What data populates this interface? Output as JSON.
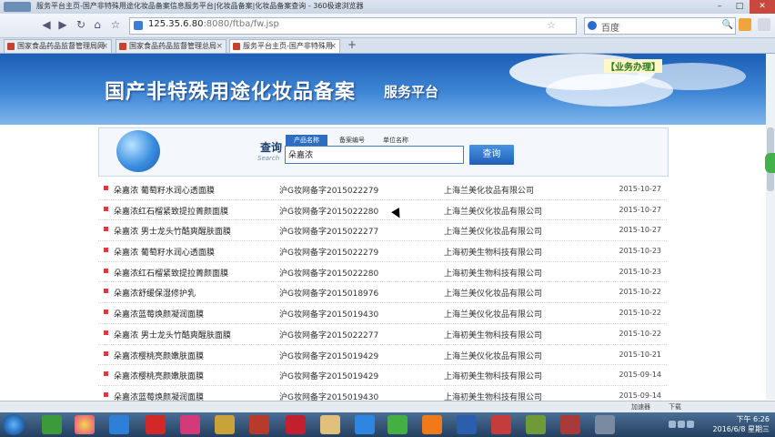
{
  "window": {
    "title": "服务平台主页-国产非特殊用途化妆品备案信息服务平台|化妆品备案|化妆品备案查询 - 360极速浏览器"
  },
  "address": {
    "url_main": "125.35.6.80",
    "url_rest": ":8080/ftba/fw.jsp",
    "search_placeholder": "百度"
  },
  "tabs": [
    {
      "label": "国家食品药品监督管理局网"
    },
    {
      "label": "国家食品药品监督管理总局"
    },
    {
      "label": "服务平台主页-国产非特殊用"
    }
  ],
  "banner": {
    "title": "国产非特殊用途化妆品备案",
    "subtitle": "服务平台",
    "biz_link": "【业务办理】"
  },
  "search_panel": {
    "label": "查询",
    "label_sub": "Search",
    "tabs": [
      "产品名称",
      "备案编号",
      "单位名称"
    ],
    "input_value": "朵嘉浓",
    "button_label": "查询"
  },
  "results": [
    {
      "name": "朵嘉浓 葡萄籽水润心透面膜",
      "code": "沪G妆网备字2015022279",
      "company": "上海兰美化妆品有限公司",
      "date": "2015-10-27"
    },
    {
      "name": "朵嘉浓红石榴紧致提拉菁颜面膜",
      "code": "沪G妆网备字2015022280",
      "company": "上海兰美仪化妆品有限公司",
      "date": "2015-10-27"
    },
    {
      "name": "朵嘉浓 男士龙头竹酷爽醒肤面膜",
      "code": "沪G妆网备字2015022277",
      "company": "上海兰美仪化妆品有限公司",
      "date": "2015-10-27"
    },
    {
      "name": "朵嘉浓 葡萄籽水润心透面膜",
      "code": "沪G妆网备字2015022279",
      "company": "上海初美生物科技有限公司",
      "date": "2015-10-23"
    },
    {
      "name": "朵嘉浓红石榴紧致提拉菁颜面膜",
      "code": "沪G妆网备字2015022280",
      "company": "上海初美生物科技有限公司",
      "date": "2015-10-23"
    },
    {
      "name": "朵嘉浓舒缓保湿修护乳",
      "code": "沪G妆网备字2015018976",
      "company": "上海兰美仪化妆品有限公司",
      "date": "2015-10-22"
    },
    {
      "name": "朵嘉浓蓝莓焕颜凝润面膜",
      "code": "沪G妆网备字2015019430",
      "company": "上海兰美仪化妆品有限公司",
      "date": "2015-10-22"
    },
    {
      "name": "朵嘉浓 男士龙头竹酷爽醒肤面膜",
      "code": "沪G妆网备字2015022277",
      "company": "上海初美生物科技有限公司",
      "date": "2015-10-22"
    },
    {
      "name": "朵嘉浓樱桃亮颜嫩肤面膜",
      "code": "沪G妆网备字2015019429",
      "company": "上海兰美仪化妆品有限公司",
      "date": "2015-10-21"
    },
    {
      "name": "朵嘉浓樱桃亮颜嫩肤面膜",
      "code": "沪G妆网备字2015019429",
      "company": "上海初美生物科技有限公司",
      "date": "2015-09-14"
    },
    {
      "name": "朵嘉浓蓝莓焕颜凝润面膜",
      "code": "沪G妆网备字2015019430",
      "company": "上海初美生物科技有限公司",
      "date": "2015-09-14"
    }
  ],
  "statusbar": {
    "accelerator": "加速器",
    "download": "下载"
  },
  "taskbar": {
    "time": "下午 6:26",
    "date": "2016/6/8 星期三"
  },
  "colors": {
    "banner_blue": "#1c5fb6",
    "accent_blue": "#2c6fc2",
    "bullet_red": "#d93a3a",
    "biz_green": "#2d7a1e"
  }
}
